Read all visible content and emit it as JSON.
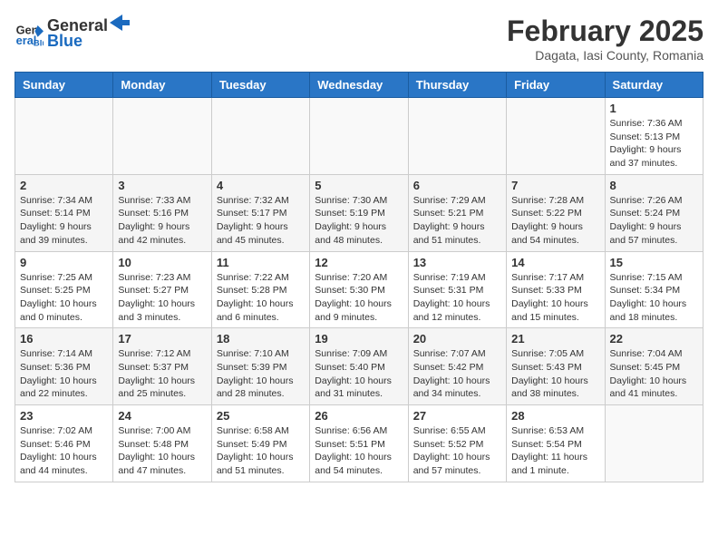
{
  "header": {
    "logo_line1": "General",
    "logo_line2": "Blue",
    "month_title": "February 2025",
    "location": "Dagata, Iasi County, Romania"
  },
  "days_of_week": [
    "Sunday",
    "Monday",
    "Tuesday",
    "Wednesday",
    "Thursday",
    "Friday",
    "Saturday"
  ],
  "weeks": [
    [
      {
        "day": "",
        "info": ""
      },
      {
        "day": "",
        "info": ""
      },
      {
        "day": "",
        "info": ""
      },
      {
        "day": "",
        "info": ""
      },
      {
        "day": "",
        "info": ""
      },
      {
        "day": "",
        "info": ""
      },
      {
        "day": "1",
        "info": "Sunrise: 7:36 AM\nSunset: 5:13 PM\nDaylight: 9 hours and 37 minutes."
      }
    ],
    [
      {
        "day": "2",
        "info": "Sunrise: 7:34 AM\nSunset: 5:14 PM\nDaylight: 9 hours and 39 minutes."
      },
      {
        "day": "3",
        "info": "Sunrise: 7:33 AM\nSunset: 5:16 PM\nDaylight: 9 hours and 42 minutes."
      },
      {
        "day": "4",
        "info": "Sunrise: 7:32 AM\nSunset: 5:17 PM\nDaylight: 9 hours and 45 minutes."
      },
      {
        "day": "5",
        "info": "Sunrise: 7:30 AM\nSunset: 5:19 PM\nDaylight: 9 hours and 48 minutes."
      },
      {
        "day": "6",
        "info": "Sunrise: 7:29 AM\nSunset: 5:21 PM\nDaylight: 9 hours and 51 minutes."
      },
      {
        "day": "7",
        "info": "Sunrise: 7:28 AM\nSunset: 5:22 PM\nDaylight: 9 hours and 54 minutes."
      },
      {
        "day": "8",
        "info": "Sunrise: 7:26 AM\nSunset: 5:24 PM\nDaylight: 9 hours and 57 minutes."
      }
    ],
    [
      {
        "day": "9",
        "info": "Sunrise: 7:25 AM\nSunset: 5:25 PM\nDaylight: 10 hours and 0 minutes."
      },
      {
        "day": "10",
        "info": "Sunrise: 7:23 AM\nSunset: 5:27 PM\nDaylight: 10 hours and 3 minutes."
      },
      {
        "day": "11",
        "info": "Sunrise: 7:22 AM\nSunset: 5:28 PM\nDaylight: 10 hours and 6 minutes."
      },
      {
        "day": "12",
        "info": "Sunrise: 7:20 AM\nSunset: 5:30 PM\nDaylight: 10 hours and 9 minutes."
      },
      {
        "day": "13",
        "info": "Sunrise: 7:19 AM\nSunset: 5:31 PM\nDaylight: 10 hours and 12 minutes."
      },
      {
        "day": "14",
        "info": "Sunrise: 7:17 AM\nSunset: 5:33 PM\nDaylight: 10 hours and 15 minutes."
      },
      {
        "day": "15",
        "info": "Sunrise: 7:15 AM\nSunset: 5:34 PM\nDaylight: 10 hours and 18 minutes."
      }
    ],
    [
      {
        "day": "16",
        "info": "Sunrise: 7:14 AM\nSunset: 5:36 PM\nDaylight: 10 hours and 22 minutes."
      },
      {
        "day": "17",
        "info": "Sunrise: 7:12 AM\nSunset: 5:37 PM\nDaylight: 10 hours and 25 minutes."
      },
      {
        "day": "18",
        "info": "Sunrise: 7:10 AM\nSunset: 5:39 PM\nDaylight: 10 hours and 28 minutes."
      },
      {
        "day": "19",
        "info": "Sunrise: 7:09 AM\nSunset: 5:40 PM\nDaylight: 10 hours and 31 minutes."
      },
      {
        "day": "20",
        "info": "Sunrise: 7:07 AM\nSunset: 5:42 PM\nDaylight: 10 hours and 34 minutes."
      },
      {
        "day": "21",
        "info": "Sunrise: 7:05 AM\nSunset: 5:43 PM\nDaylight: 10 hours and 38 minutes."
      },
      {
        "day": "22",
        "info": "Sunrise: 7:04 AM\nSunset: 5:45 PM\nDaylight: 10 hours and 41 minutes."
      }
    ],
    [
      {
        "day": "23",
        "info": "Sunrise: 7:02 AM\nSunset: 5:46 PM\nDaylight: 10 hours and 44 minutes."
      },
      {
        "day": "24",
        "info": "Sunrise: 7:00 AM\nSunset: 5:48 PM\nDaylight: 10 hours and 47 minutes."
      },
      {
        "day": "25",
        "info": "Sunrise: 6:58 AM\nSunset: 5:49 PM\nDaylight: 10 hours and 51 minutes."
      },
      {
        "day": "26",
        "info": "Sunrise: 6:56 AM\nSunset: 5:51 PM\nDaylight: 10 hours and 54 minutes."
      },
      {
        "day": "27",
        "info": "Sunrise: 6:55 AM\nSunset: 5:52 PM\nDaylight: 10 hours and 57 minutes."
      },
      {
        "day": "28",
        "info": "Sunrise: 6:53 AM\nSunset: 5:54 PM\nDaylight: 11 hours and 1 minute."
      },
      {
        "day": "",
        "info": ""
      }
    ]
  ]
}
